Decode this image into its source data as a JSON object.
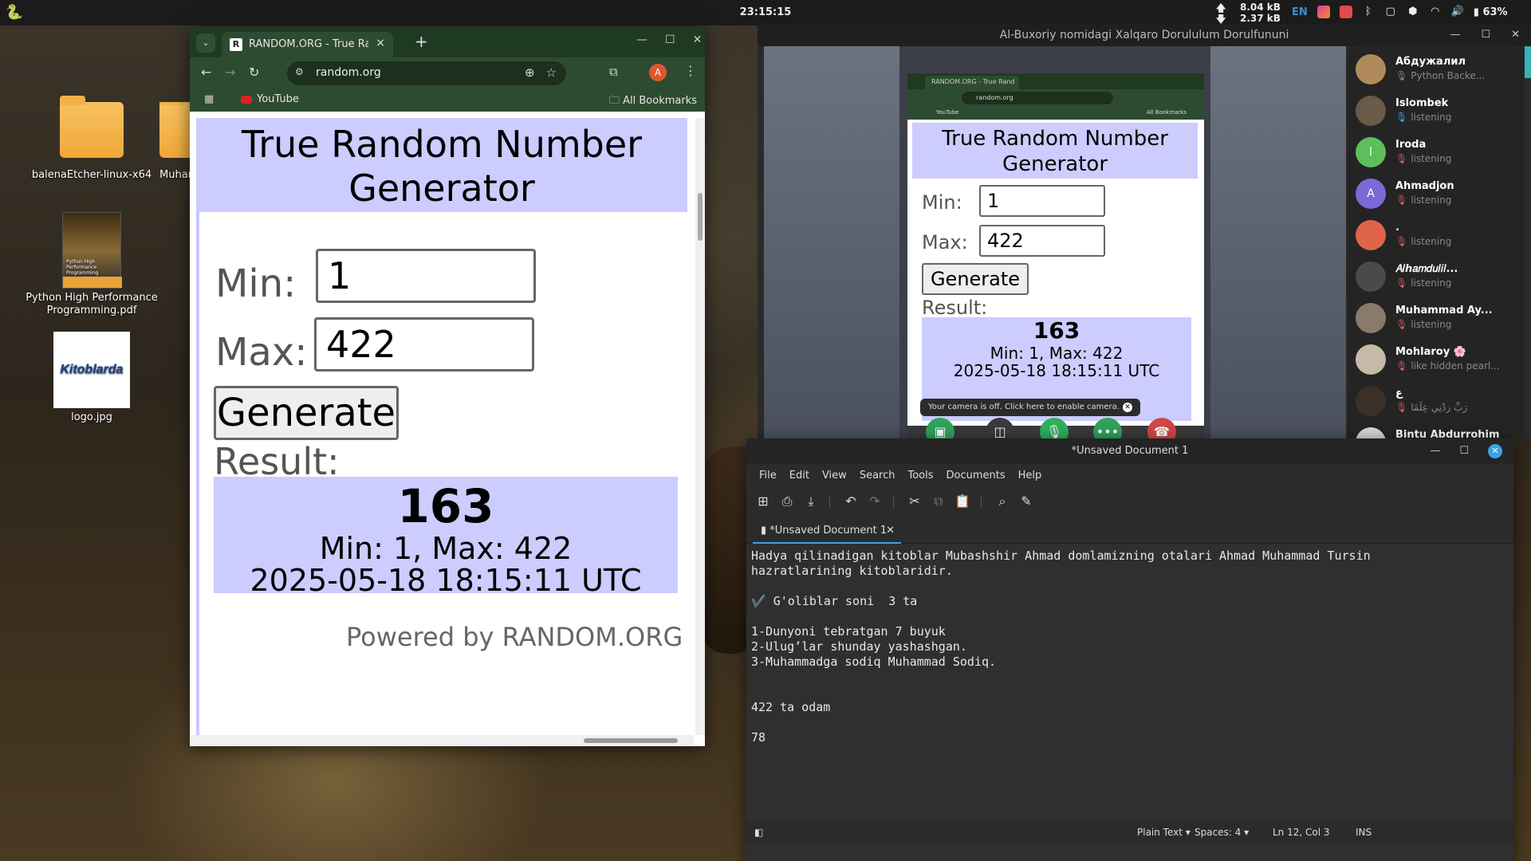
{
  "topbar": {
    "clock": "23:15:15",
    "net_up": "8.04 kB",
    "net_down": "2.37 kB",
    "lang": "EN",
    "battery": "63%"
  },
  "desktop": {
    "items": [
      {
        "label": "balenaEtcher-linux-x64"
      },
      {
        "label": "Muhamm"
      },
      {
        "label": "Python High Performance Programming.pdf"
      },
      {
        "label": "logo.jpg"
      }
    ],
    "logo_text": "Kitoblarda"
  },
  "chrome": {
    "tab_title": "RANDOM.ORG - True Random",
    "url": "random.org",
    "avatar_letter": "A",
    "bookmark_youtube": "YouTube",
    "all_bookmarks": "All Bookmarks",
    "page": {
      "header": "True Random Number Generator",
      "min_label": "Min:",
      "min_value": "1",
      "max_label": "Max:",
      "max_value": "422",
      "generate": "Generate",
      "result_label": "Result:",
      "result_number": "163",
      "result_range": "Min: 1, Max: 422",
      "result_time": "2025-05-18 18:15:11 UTC",
      "powered": "Powered by RANDOM.ORG"
    }
  },
  "telegram": {
    "window_title": "Al-Buxoriy nomidagi Xalqaro Dorululum Dorulfununi",
    "mini_tab": "RANDOM.ORG - True Rand",
    "mini_url": "random.org",
    "mini_youtube": "YouTube",
    "mini_allbm": "All Bookmarks",
    "tooltip": "Your camera is off. Click here to enable camera.",
    "participants": [
      {
        "name": "Абдужалил",
        "status": "Python Backe...",
        "color": "#b08a5a",
        "initial": "",
        "mic": "gray"
      },
      {
        "name": "Islombek",
        "status": "listening",
        "color": "#6a5a48",
        "initial": "",
        "mic": "on"
      },
      {
        "name": "Iroda",
        "status": "listening",
        "color": "#5cbf5a",
        "initial": "I",
        "mic": "off"
      },
      {
        "name": "Ahmadjon",
        "status": "listening",
        "color": "#7a6ad8",
        "initial": "A",
        "mic": "off"
      },
      {
        "name": ".",
        "status": "listening",
        "color": "#e0644a",
        "initial": "",
        "mic": "off"
      },
      {
        "name": "𝐴𝑙ℎ𝑎𝑚𝑑𝑢𝑙𝑖𝑙...",
        "status": "listening",
        "color": "#4a4a4a",
        "initial": "",
        "mic": "off"
      },
      {
        "name": "Muhammad Ay...",
        "status": "listening",
        "color": "#8a7a6a",
        "initial": "",
        "mic": "off"
      },
      {
        "name": "Mohlaroy 🌸",
        "status": "like hidden pearl...",
        "color": "#c8b8a8",
        "initial": "",
        "mic": "off"
      },
      {
        "name": "ع",
        "status": "رَبِّ زِدْنِي عِلْمًا",
        "color": "#3a3028",
        "initial": "",
        "mic": "off"
      },
      {
        "name": "Bintu Abdurrohim",
        "status": "",
        "color": "#d8d8d8",
        "initial": "",
        "mic": "off"
      }
    ]
  },
  "gedit": {
    "title": "*Unsaved Document 1",
    "menu": [
      "File",
      "Edit",
      "View",
      "Search",
      "Tools",
      "Documents",
      "Help"
    ],
    "tab_label": "*Unsaved Document 1",
    "text_lines": [
      "Hadya qilinadigan kitoblar Mubashshir Ahmad domlamizning otalari Ahmad Muhammad Tursin",
      "hazratlarining kitoblaridir.",
      "",
      "✔️ G'oliblar soni  3 ta",
      "",
      "1-Dunyoni tebratgan 7 buyuk",
      "2-Ulug’lar shunday yashashgan.",
      "3-Muhammadga sodiq Muhammad Sodiq.",
      "",
      "",
      "422 ta odam",
      "",
      "78"
    ],
    "status": {
      "language": "Plain Text",
      "spaces": "Spaces: 4",
      "position": "Ln 12, Col 3",
      "mode": "INS"
    }
  }
}
